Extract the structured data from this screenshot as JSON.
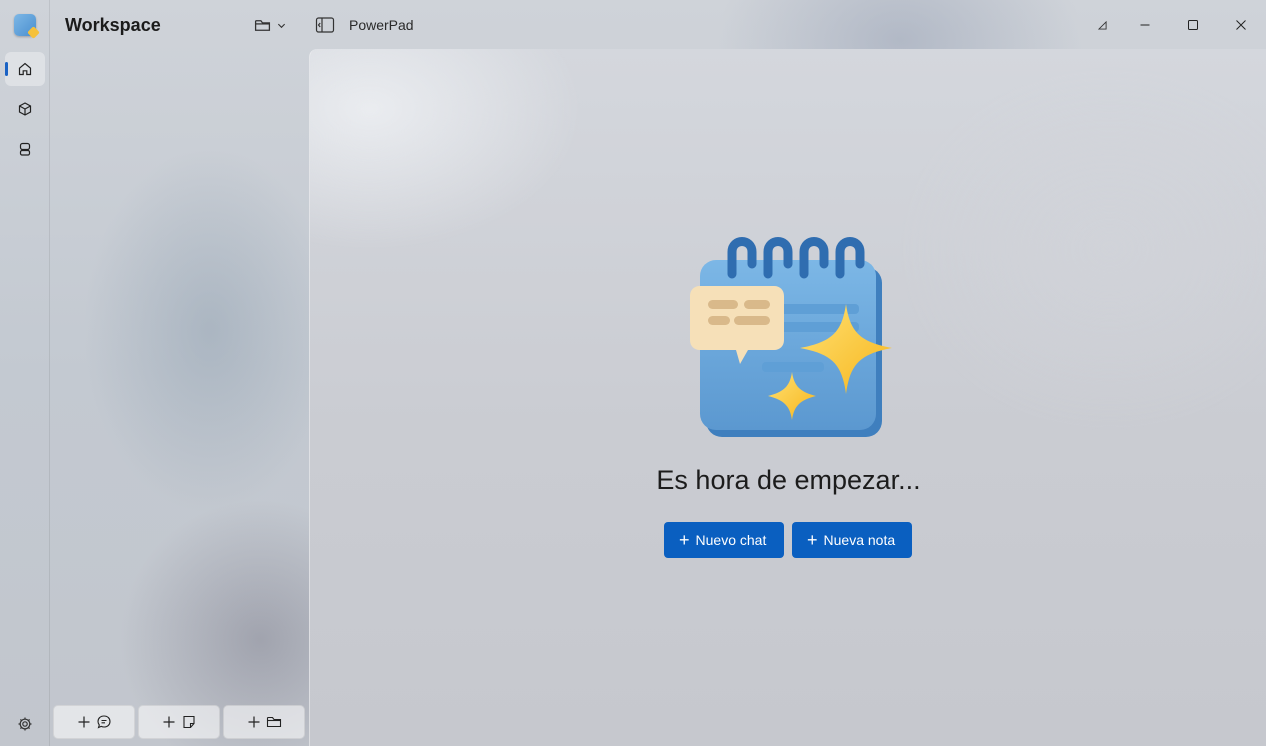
{
  "app": {
    "name": "PowerPad",
    "workspace_title": "Workspace"
  },
  "rail": {
    "items": [
      {
        "id": "home",
        "icon": "home-icon",
        "active": true
      },
      {
        "id": "models",
        "icon": "cube-icon",
        "active": false
      },
      {
        "id": "agents",
        "icon": "robot-icon",
        "active": false
      }
    ],
    "settings_icon": "gear-icon"
  },
  "sidebar": {
    "bottom_buttons": [
      {
        "id": "new-chat",
        "icon": "chat-bubble-icon"
      },
      {
        "id": "new-note",
        "icon": "note-icon"
      },
      {
        "id": "new-folder",
        "icon": "folder-icon"
      }
    ]
  },
  "main": {
    "headline": "Es hora de empezar...",
    "buttons": {
      "new_chat": "Nuevo chat",
      "new_note": "Nueva nota"
    }
  },
  "colors": {
    "accent": "#0a5fc0",
    "rail_indicator": "#1a62c4"
  }
}
